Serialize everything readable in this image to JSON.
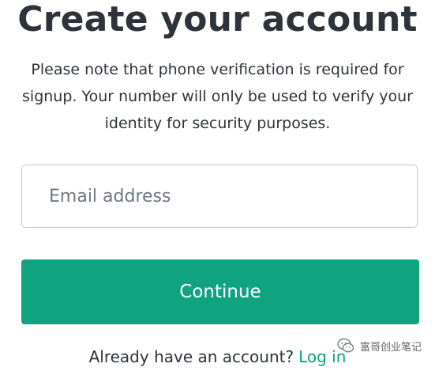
{
  "page": {
    "title": "Create your account",
    "note": "Please note that phone verification is required for signup. Your number will only be used to verify your identity for security purposes."
  },
  "form": {
    "email_placeholder": "Email address",
    "email_value": "",
    "continue_label": "Continue"
  },
  "footer": {
    "prompt": "Already have an account?",
    "login_label": "Log in"
  },
  "watermark": {
    "icon": "wechat-icon",
    "text": "富哥创业笔记"
  },
  "colors": {
    "accent": "#10a37f",
    "text": "#2d333a",
    "border": "#c2c8d0"
  }
}
